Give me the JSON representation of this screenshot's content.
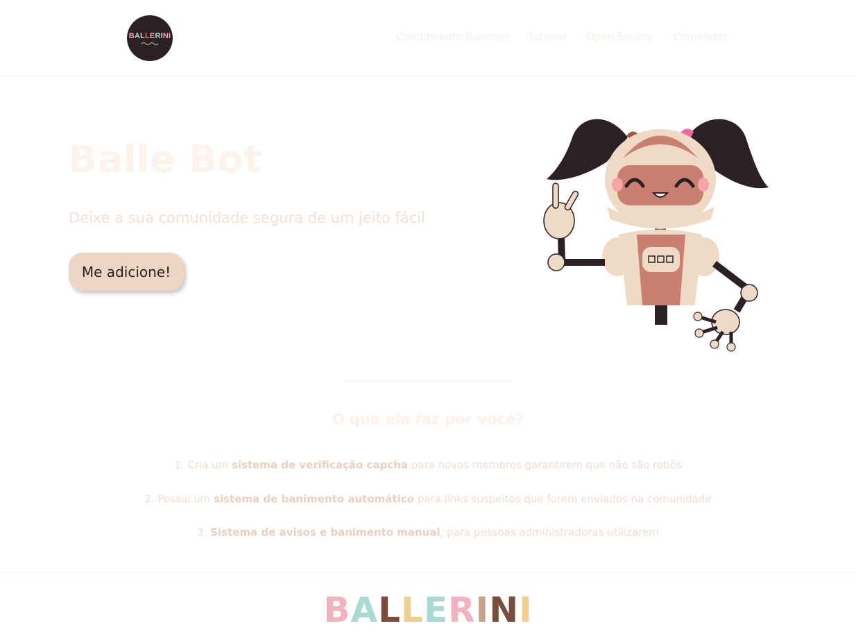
{
  "header": {
    "logo_text": "BALLERINI",
    "nav": [
      {
        "label": "Comunidade Ballerini"
      },
      {
        "label": "Tutorial"
      },
      {
        "label": "Open Source"
      },
      {
        "label": "Comandos"
      }
    ]
  },
  "hero": {
    "title": "Balle Bot",
    "subtitle": "Deixe a sua comunidade segura de um jeito fácil",
    "cta_label": "Me adicione!",
    "illustration": "robot-girl-mascot"
  },
  "features": {
    "title": "O que ela faz por você?",
    "items": [
      {
        "prefix": "1. Cria um ",
        "bold": "sistema de verificação capcha",
        "suffix": " para novos membros garantirem que não são robôs"
      },
      {
        "prefix": "2. Possui um ",
        "bold": "sistema de banimento automático",
        "suffix": " para links suspeitos que forem enviados na comunidade"
      },
      {
        "prefix": "3. ",
        "bold": "Sistema de avisos e banimento manual",
        "suffix": ", para pessoas administradoras utilizarem"
      }
    ]
  },
  "footer": {
    "logo_letters": [
      "B",
      "A",
      "L",
      "L",
      "E",
      "R",
      "I",
      "N",
      "I"
    ]
  },
  "colors": {
    "dark": "#2b2025",
    "button": "#edd6c3",
    "robot_skin": "#ca8070",
    "robot_light": "#efdac6"
  }
}
